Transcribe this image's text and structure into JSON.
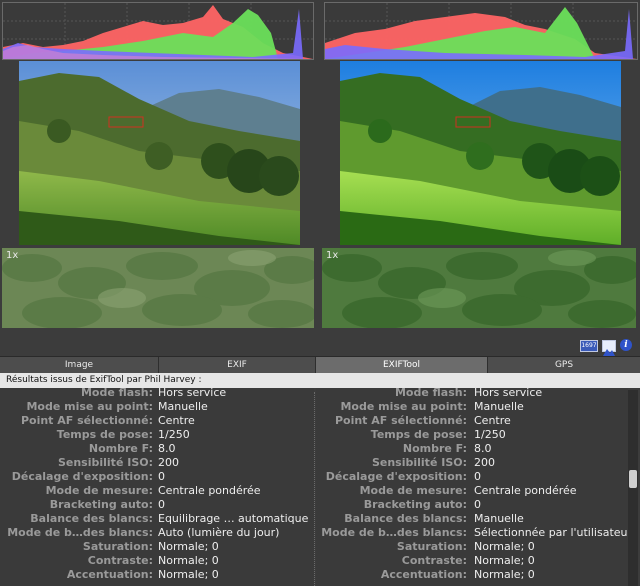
{
  "photos": {
    "zoom_label": "1x"
  },
  "icons": [
    "1697-badge-icon",
    "mountain-image-icon",
    "info-icon"
  ],
  "icon_labels": {
    "badge": "1697",
    "info": "i"
  },
  "tabs": [
    {
      "label": "Image",
      "active": false
    },
    {
      "label": "EXIF",
      "active": false
    },
    {
      "label": "EXIFTool",
      "active": true
    },
    {
      "label": "GPS",
      "active": false
    }
  ],
  "results_header": "Résultats issus de ExifTool par Phil Harvey :",
  "exif_left": [
    {
      "label": "Mode flash:",
      "value": "Hors service"
    },
    {
      "label": "Mode mise au point:",
      "value": "Manuelle"
    },
    {
      "label": "Point AF sélectionné:",
      "value": "Centre"
    },
    {
      "label": "Temps de pose:",
      "value": "1/250"
    },
    {
      "label": "Nombre F:",
      "value": "8.0"
    },
    {
      "label": "Sensibilité ISO:",
      "value": "200"
    },
    {
      "label": "Décalage d'exposition:",
      "value": "0"
    },
    {
      "label": "Mode de mesure:",
      "value": "Centrale pondérée"
    },
    {
      "label": "Bracketing auto:",
      "value": "0"
    },
    {
      "label": "Balance des blancs:",
      "value": "Equilibrage … automatique"
    },
    {
      "label": "Mode de b…des blancs:",
      "value": "Auto (lumière du jour)"
    },
    {
      "label": "Saturation:",
      "value": "Normale; 0"
    },
    {
      "label": "Contraste:",
      "value": "Normale; 0"
    },
    {
      "label": "Accentuation:",
      "value": "Normale; 0"
    }
  ],
  "exif_right": [
    {
      "label": "Mode flash:",
      "value": "Hors service"
    },
    {
      "label": "Mode mise au point:",
      "value": "Manuelle"
    },
    {
      "label": "Point AF sélectionné:",
      "value": "Centre"
    },
    {
      "label": "Temps de pose:",
      "value": "1/250"
    },
    {
      "label": "Nombre F:",
      "value": "8.0"
    },
    {
      "label": "Sensibilité ISO:",
      "value": "200"
    },
    {
      "label": "Décalage d'exposition:",
      "value": "0"
    },
    {
      "label": "Mode de mesure:",
      "value": "Centrale pondérée"
    },
    {
      "label": "Bracketing auto:",
      "value": "0"
    },
    {
      "label": "Balance des blancs:",
      "value": "Manuelle"
    },
    {
      "label": "Mode de b…des blancs:",
      "value": "Sélectionnée par l'utilisateur"
    },
    {
      "label": "Saturation:",
      "value": "Normale; 0"
    },
    {
      "label": "Contraste:",
      "value": "Normale; 0"
    },
    {
      "label": "Accentuation:",
      "value": "Normale; 0"
    }
  ],
  "colors": {
    "background": "#3c3c3c",
    "active_tab": "#6c6c6c",
    "label_text": "#9a9a9a",
    "value_text": "#eeeeee",
    "histogram_red": "#ff6060",
    "histogram_green": "#60d060",
    "histogram_blue": "#6060ff"
  }
}
